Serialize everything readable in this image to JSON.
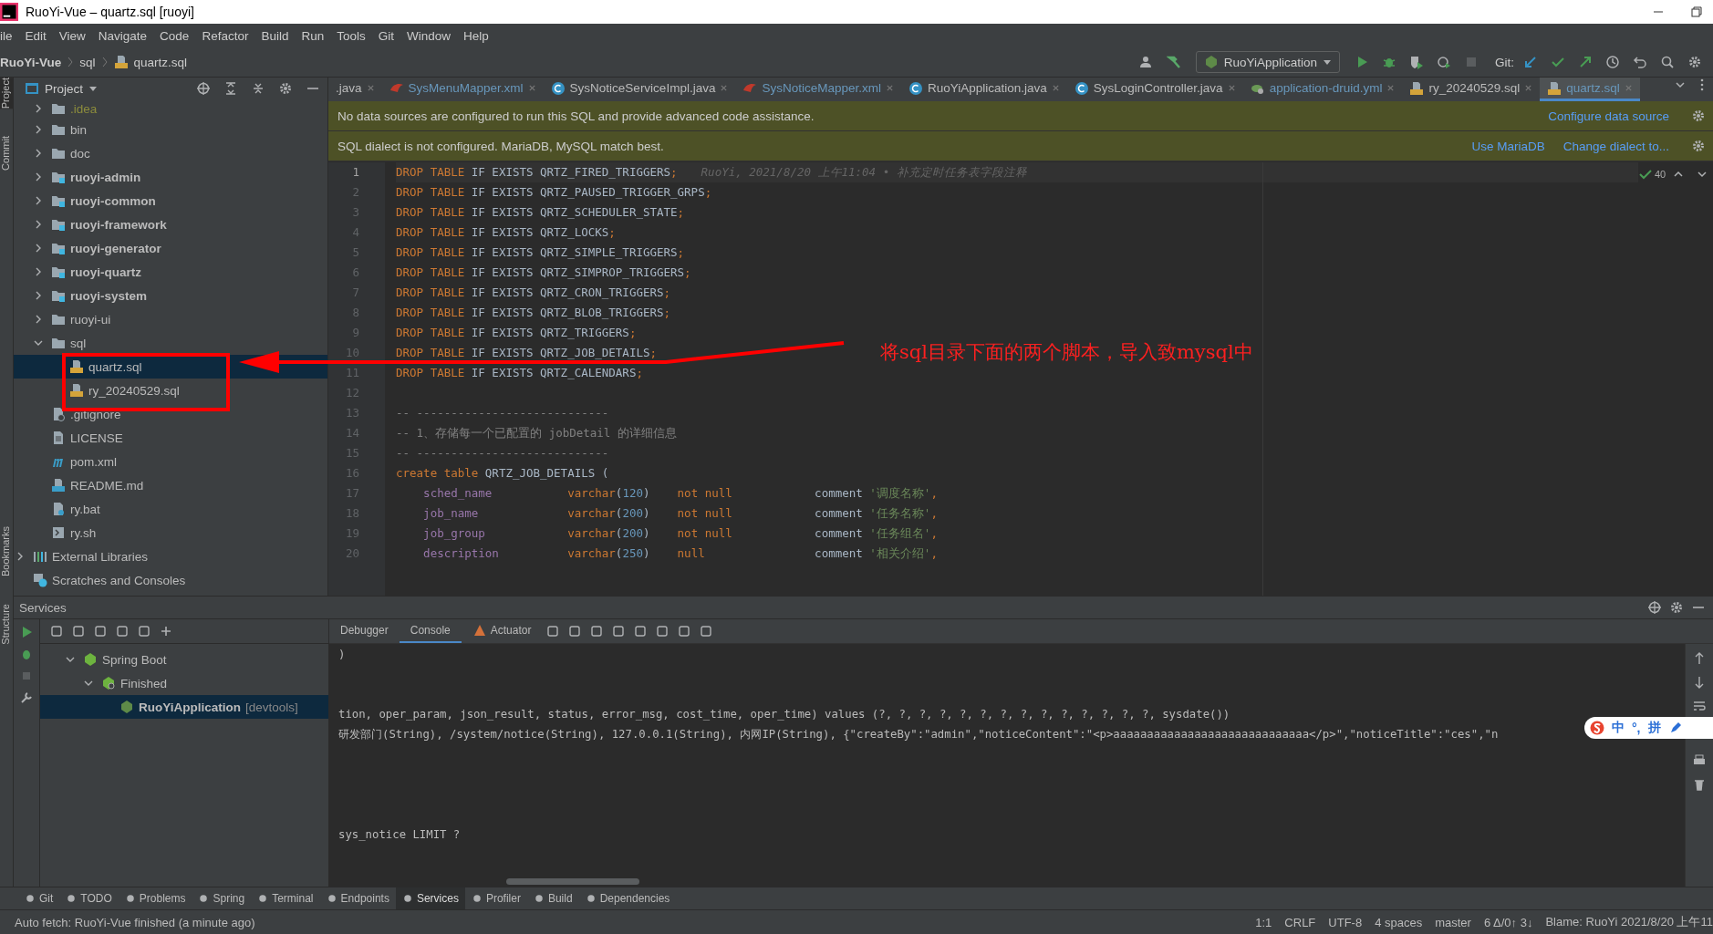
{
  "window": {
    "title": "RuoYi-Vue – quartz.sql [ruoyi]"
  },
  "menu": [
    "ile",
    "Edit",
    "View",
    "Navigate",
    "Code",
    "Refactor",
    "Build",
    "Run",
    "Tools",
    "Git",
    "Window",
    "Help"
  ],
  "breadcrumb": [
    "RuoYi-Vue",
    "sql",
    "quartz.sql"
  ],
  "toolbar": {
    "run_config": "RuoYiApplication",
    "git_label": "Git:"
  },
  "side_strip": [
    {
      "label": "Project",
      "selected": true
    },
    {
      "label": "Commit",
      "selected": false
    },
    {
      "label": "Bookmarks",
      "selected": false
    },
    {
      "label": "Structure",
      "selected": false
    }
  ],
  "project_panel": {
    "title": "Project",
    "tree": [
      {
        "label": ".idea",
        "kind": "folder",
        "expanded": false,
        "excluded": true,
        "selected": false
      },
      {
        "label": "bin",
        "kind": "folder",
        "expanded": false,
        "selected": false
      },
      {
        "label": "doc",
        "kind": "folder",
        "expanded": false,
        "selected": false
      },
      {
        "label": "ruoyi-admin",
        "kind": "module",
        "expanded": false,
        "selected": false
      },
      {
        "label": "ruoyi-common",
        "kind": "module",
        "expanded": false,
        "selected": false
      },
      {
        "label": "ruoyi-framework",
        "kind": "module",
        "expanded": false,
        "selected": false
      },
      {
        "label": "ruoyi-generator",
        "kind": "module",
        "expanded": false,
        "selected": false
      },
      {
        "label": "ruoyi-quartz",
        "kind": "module",
        "expanded": false,
        "selected": false
      },
      {
        "label": "ruoyi-system",
        "kind": "module",
        "expanded": false,
        "selected": false
      },
      {
        "label": "ruoyi-ui",
        "kind": "folder",
        "expanded": false,
        "selected": false
      },
      {
        "label": "sql",
        "kind": "folder",
        "expanded": true,
        "selected": false,
        "children": [
          {
            "label": "quartz.sql",
            "kind": "sql",
            "selected": true
          },
          {
            "label": "ry_20240529.sql",
            "kind": "sql",
            "selected": false
          }
        ]
      },
      {
        "label": ".gitignore",
        "kind": "ignore",
        "selected": false
      },
      {
        "label": "LICENSE",
        "kind": "text",
        "selected": false
      },
      {
        "label": "pom.xml",
        "kind": "maven",
        "selected": false
      },
      {
        "label": "README.md",
        "kind": "md",
        "selected": false
      },
      {
        "label": "ry.bat",
        "kind": "bat",
        "selected": false
      },
      {
        "label": "ry.sh",
        "kind": "sh",
        "selected": false
      }
    ],
    "roots": [
      {
        "label": "External Libraries",
        "kind": "libs"
      },
      {
        "label": "Scratches and Consoles",
        "kind": "scratch"
      }
    ]
  },
  "tabs": [
    {
      "label": ".java",
      "kind": "none",
      "modified": false,
      "selected": false
    },
    {
      "label": "SysMenuMapper.xml",
      "kind": "xml",
      "modified": true,
      "selected": false
    },
    {
      "label": "SysNoticeServiceImpl.java",
      "kind": "class",
      "modified": false,
      "selected": false
    },
    {
      "label": "SysNoticeMapper.xml",
      "kind": "xml",
      "modified": true,
      "selected": false
    },
    {
      "label": "RuoYiApplication.java",
      "kind": "class",
      "modified": false,
      "selected": false
    },
    {
      "label": "SysLoginController.java",
      "kind": "class",
      "modified": false,
      "selected": false
    },
    {
      "label": "application-druid.yml",
      "kind": "yml",
      "modified": true,
      "selected": false
    },
    {
      "label": "ry_20240529.sql",
      "kind": "sql",
      "modified": false,
      "selected": false
    },
    {
      "label": "quartz.sql",
      "kind": "sql",
      "modified": true,
      "selected": true
    }
  ],
  "banners": [
    {
      "text": "No data sources are configured to run this SQL and provide advanced code assistance.",
      "actions": [
        "Configure data source"
      ]
    },
    {
      "text": "SQL dialect is not configured. MariaDB, MySQL match best.",
      "actions": [
        "Use MariaDB",
        "Change dialect to..."
      ]
    }
  ],
  "editor": {
    "inspections": "40",
    "blame": "RuoYi, 2021/8/20 上午11:04 • 补充定时任务表字段注释",
    "lines": [
      {
        "number": "1",
        "tokens": [
          {
            "text": "DROP TABLE",
            "kind": "kw"
          },
          {
            "text": " IF EXISTS QRTZ_FIRED_TRIGGERS",
            "kind": "id"
          },
          {
            "text": ";",
            "kind": "kw"
          }
        ]
      },
      {
        "number": "2",
        "tokens": [
          {
            "text": "DROP TABLE",
            "kind": "kw"
          },
          {
            "text": " IF EXISTS QRTZ_PAUSED_TRIGGER_GRPS",
            "kind": "id"
          },
          {
            "text": ";",
            "kind": "kw"
          }
        ]
      },
      {
        "number": "3",
        "tokens": [
          {
            "text": "DROP TABLE",
            "kind": "kw"
          },
          {
            "text": " IF EXISTS QRTZ_SCHEDULER_STATE",
            "kind": "id"
          },
          {
            "text": ";",
            "kind": "kw"
          }
        ]
      },
      {
        "number": "4",
        "tokens": [
          {
            "text": "DROP TABLE",
            "kind": "kw"
          },
          {
            "text": " IF EXISTS QRTZ_LOCKS",
            "kind": "id"
          },
          {
            "text": ";",
            "kind": "kw"
          }
        ]
      },
      {
        "number": "5",
        "tokens": [
          {
            "text": "DROP TABLE",
            "kind": "kw"
          },
          {
            "text": " IF EXISTS QRTZ_SIMPLE_TRIGGERS",
            "kind": "id"
          },
          {
            "text": ";",
            "kind": "kw"
          }
        ]
      },
      {
        "number": "6",
        "tokens": [
          {
            "text": "DROP TABLE",
            "kind": "kw"
          },
          {
            "text": " IF EXISTS QRTZ_SIMPROP_TRIGGERS",
            "kind": "id"
          },
          {
            "text": ";",
            "kind": "kw"
          }
        ]
      },
      {
        "number": "7",
        "tokens": [
          {
            "text": "DROP TABLE",
            "kind": "kw"
          },
          {
            "text": " IF EXISTS QRTZ_CRON_TRIGGERS",
            "kind": "id"
          },
          {
            "text": ";",
            "kind": "kw"
          }
        ]
      },
      {
        "number": "8",
        "tokens": [
          {
            "text": "DROP TABLE",
            "kind": "kw"
          },
          {
            "text": " IF EXISTS QRTZ_BLOB_TRIGGERS",
            "kind": "id"
          },
          {
            "text": ";",
            "kind": "kw"
          }
        ]
      },
      {
        "number": "9",
        "tokens": [
          {
            "text": "DROP TABLE",
            "kind": "kw"
          },
          {
            "text": " IF EXISTS QRTZ_TRIGGERS",
            "kind": "id"
          },
          {
            "text": ";",
            "kind": "kw"
          }
        ]
      },
      {
        "number": "10",
        "tokens": [
          {
            "text": "DROP TABLE",
            "kind": "kw"
          },
          {
            "text": " IF EXISTS QRTZ_JOB_DETAILS",
            "kind": "id"
          },
          {
            "text": ";",
            "kind": "kw"
          }
        ]
      },
      {
        "number": "11",
        "tokens": [
          {
            "text": "DROP TABLE",
            "kind": "kw"
          },
          {
            "text": " IF EXISTS QRTZ_CALENDARS",
            "kind": "id"
          },
          {
            "text": ";",
            "kind": "kw"
          }
        ]
      },
      {
        "number": "12"
      },
      {
        "number": "13",
        "tokens": [
          {
            "text": "-- ----------------------------",
            "kind": "cm"
          }
        ]
      },
      {
        "number": "14",
        "tokens": [
          {
            "text": "-- 1、存储每一个已配置的 jobDetail 的详细信息",
            "kind": "cm"
          }
        ]
      },
      {
        "number": "15",
        "tokens": [
          {
            "text": "-- ----------------------------",
            "kind": "cm"
          }
        ]
      },
      {
        "number": "16",
        "tokens": [
          {
            "text": "create table",
            "kind": "kw"
          },
          {
            "text": " QRTZ_JOB_DETAILS (",
            "kind": "id"
          }
        ]
      },
      {
        "number": "17",
        "tokens": [
          {
            "text": "    sched_name           ",
            "kind": "col"
          },
          {
            "text": "varchar",
            "kind": "kw"
          },
          {
            "text": "(",
            "kind": "id"
          },
          {
            "text": "120",
            "kind": "num"
          },
          {
            "text": ")    ",
            "kind": "id"
          },
          {
            "text": "not null",
            "kind": "kw"
          },
          {
            "text": "            comment ",
            "kind": "id"
          },
          {
            "text": "'调度名称'",
            "kind": "str"
          },
          {
            "text": ",",
            "kind": "kw"
          }
        ]
      },
      {
        "number": "18",
        "tokens": [
          {
            "text": "    job_name             ",
            "kind": "col"
          },
          {
            "text": "varchar",
            "kind": "kw"
          },
          {
            "text": "(",
            "kind": "id"
          },
          {
            "text": "200",
            "kind": "num"
          },
          {
            "text": ")    ",
            "kind": "id"
          },
          {
            "text": "not null",
            "kind": "kw"
          },
          {
            "text": "            comment ",
            "kind": "id"
          },
          {
            "text": "'任务名称'",
            "kind": "str"
          },
          {
            "text": ",",
            "kind": "kw"
          }
        ]
      },
      {
        "number": "19",
        "tokens": [
          {
            "text": "    job_group            ",
            "kind": "col"
          },
          {
            "text": "varchar",
            "kind": "kw"
          },
          {
            "text": "(",
            "kind": "id"
          },
          {
            "text": "200",
            "kind": "num"
          },
          {
            "text": ")    ",
            "kind": "id"
          },
          {
            "text": "not null",
            "kind": "kw"
          },
          {
            "text": "            comment ",
            "kind": "id"
          },
          {
            "text": "'任务组名'",
            "kind": "str"
          },
          {
            "text": ",",
            "kind": "kw"
          }
        ]
      },
      {
        "number": "20",
        "tokens": [
          {
            "text": "    description          ",
            "kind": "col"
          },
          {
            "text": "varchar",
            "kind": "kw"
          },
          {
            "text": "(",
            "kind": "id"
          },
          {
            "text": "250",
            "kind": "num"
          },
          {
            "text": ")    ",
            "kind": "id"
          },
          {
            "text": "null",
            "kind": "kw"
          },
          {
            "text": "                comment ",
            "kind": "id"
          },
          {
            "text": "'相关介绍'",
            "kind": "str"
          },
          {
            "text": ",",
            "kind": "kw"
          }
        ]
      }
    ]
  },
  "annotation": {
    "text": "将sql目录下面的两个脚本，导入致mysql中"
  },
  "services": {
    "title": "Services",
    "tree": [
      {
        "label": "Spring Boot",
        "kind": "boot",
        "expanded": true,
        "selected": false,
        "children": [
          {
            "label": "Finished",
            "kind": "finished",
            "expanded": true,
            "selected": false,
            "children": [
              {
                "label": "RuoYiApplication",
                "note": "[devtools]",
                "kind": "app",
                "selected": true
              }
            ]
          }
        ]
      }
    ],
    "console_tabs": [
      {
        "label": "Debugger",
        "selected": false
      },
      {
        "label": "Console",
        "selected": true
      },
      {
        "label": "Actuator",
        "selected": false
      }
    ],
    "console_lines": [
      ")",
      "tion, oper_param, json_result, status, error_msg, cost_time, oper_time) values (?, ?, ?, ?, ?, ?, ?, ?, ?, ?, ?, ?, ?, ?, sysdate())",
      "研发部门(String), /system/notice(String), 127.0.0.1(String), 内网IP(String), {\"createBy\":\"admin\",\"noticeContent\":\"<p>aaaaaaaaaaaaaaaaaaaaaaaaaaaaa</p>\",\"noticeTitle\":\"ces\",\"n",
      "sys_notice LIMIT ?"
    ]
  },
  "ime_toolbar": [
    "中",
    "°,",
    "拼"
  ],
  "tool_tabs": [
    {
      "label": "Git",
      "selected": false
    },
    {
      "label": "TODO",
      "selected": false
    },
    {
      "label": "Problems",
      "selected": false
    },
    {
      "label": "Spring",
      "selected": false
    },
    {
      "label": "Terminal",
      "selected": false
    },
    {
      "label": "Endpoints",
      "selected": false
    },
    {
      "label": "Services",
      "selected": true
    },
    {
      "label": "Profiler",
      "selected": false
    },
    {
      "label": "Build",
      "selected": false
    },
    {
      "label": "Dependencies",
      "selected": false
    }
  ],
  "status_bar": {
    "message": "Auto fetch: RuoYi-Vue finished (a minute ago)",
    "items": [
      "1:1",
      "CRLF",
      "UTF-8",
      "4 spaces",
      "master",
      "6 Δ/0↑ 3↓",
      "Blame: RuoYi 2021/8/20 上午11"
    ]
  }
}
